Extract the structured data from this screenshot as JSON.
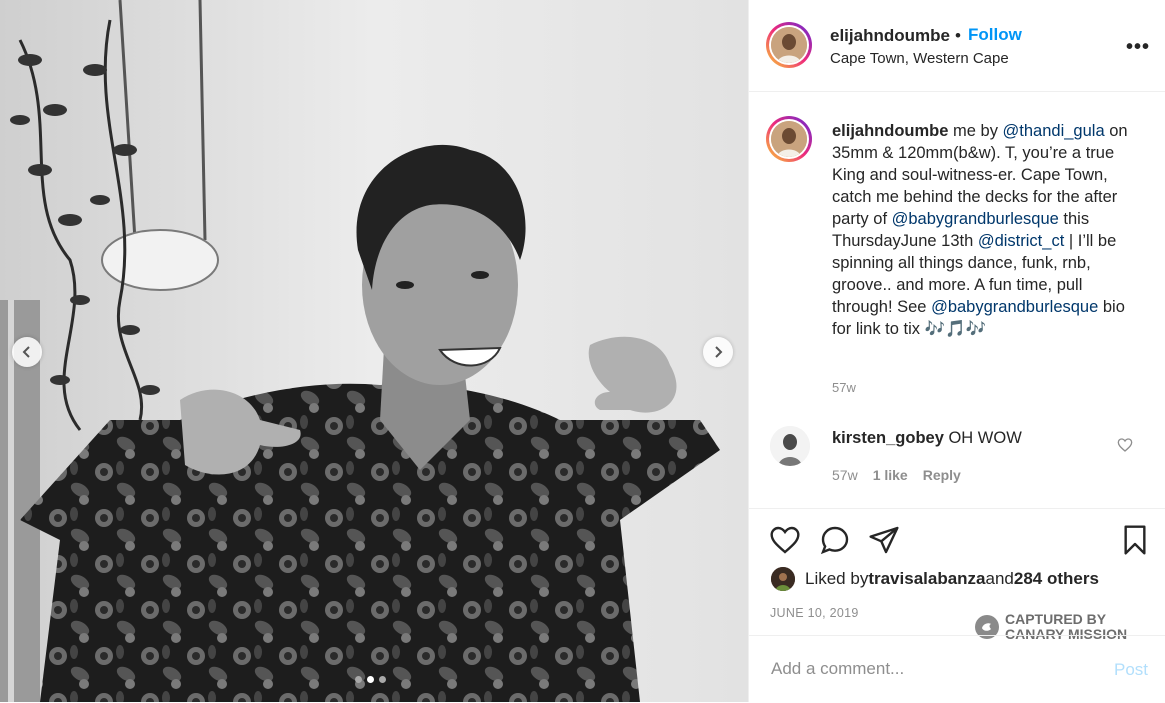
{
  "post": {
    "username": "elijahndoumbe",
    "follow_label": "Follow",
    "separator": "•",
    "location": "Cape Town, Western Cape",
    "more_label": "•••"
  },
  "caption": {
    "username": "elijahndoumbe",
    "t1": " me by ",
    "m1": "@thandi_gula",
    "t2": " on 35mm & 120mm(b&w). T, you’re a true King and soul-witness-er. Cape Town, catch me behind the decks for the after party of ",
    "m2": "@babygrandburlesque",
    "t3": " this ThursdayJune 13th ",
    "m3": "@district_ct",
    "t4": " | I’ll be spinning all things dance, funk, rnb, groove.. and more. A fun time, pull through! See ",
    "m4": "@babygrandburlesque",
    "t5": " bio for link to tix ",
    "emojis": "🎶🎵🎶",
    "time": "57w"
  },
  "comment": {
    "username": "kirsten_gobey",
    "text": " OH WOW",
    "time": "57w",
    "likes": "1 like",
    "reply_label": "Reply"
  },
  "likes": {
    "prefix": "Liked by ",
    "user": "travisalabanza",
    "middle": " and ",
    "others": "284 others"
  },
  "date": "JUNE 10, 2019",
  "watermark": {
    "line1": "CAPTURED BY",
    "line2": "CANARY MISSION"
  },
  "comment_box": {
    "placeholder": "Add a comment...",
    "post_label": "Post"
  },
  "carousel": {
    "count": 3,
    "active_index": 1
  },
  "icons": {
    "like": "heart-icon",
    "comment": "comment-icon",
    "share": "paper-plane-icon",
    "save": "bookmark-icon"
  },
  "colors": {
    "follow": "#0095f6",
    "mention": "#00376b",
    "muted": "#8e8e8e",
    "post_disabled": "#b2dffc"
  }
}
